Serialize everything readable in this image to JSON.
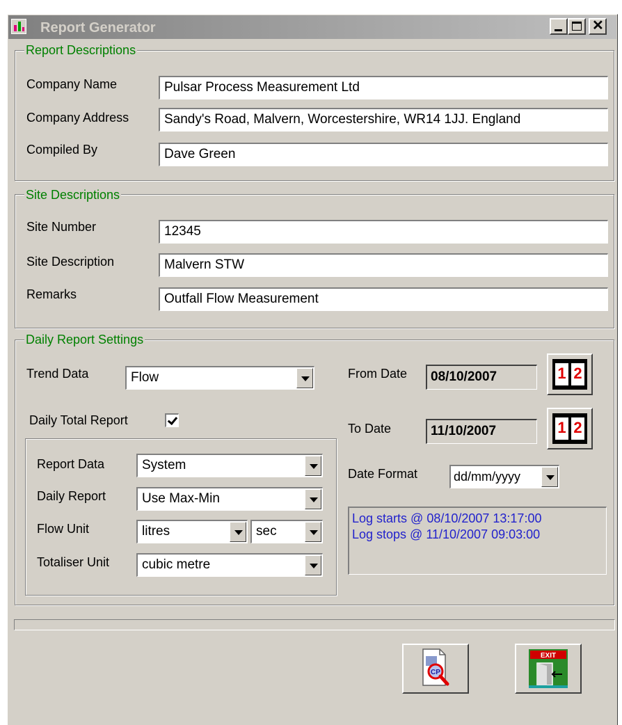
{
  "window": {
    "title": "Report Generator"
  },
  "report_descriptions": {
    "title": "Report Descriptions",
    "company_name_label": "Company Name",
    "company_name": "Pulsar Process Measurement Ltd",
    "company_address_label": "Company Address",
    "company_address": "Sandy's Road, Malvern, Worcestershire, WR14 1JJ. England",
    "compiled_by_label": "Compiled By",
    "compiled_by": "Dave Green"
  },
  "site_descriptions": {
    "title": "Site Descriptions",
    "site_number_label": "Site Number",
    "site_number": "12345",
    "site_description_label": "Site Description",
    "site_description": "Malvern STW",
    "remarks_label": "Remarks",
    "remarks": "Outfall Flow Measurement"
  },
  "daily_settings": {
    "title": "Daily Report Settings",
    "trend_data_label": "Trend Data",
    "trend_data": "Flow",
    "daily_total_label": "Daily Total Report",
    "daily_total_checked": true,
    "report_data_label": "Report Data",
    "report_data": "System",
    "daily_report_label": "Daily Report",
    "daily_report": "Use Max-Min",
    "flow_unit_label": "Flow Unit",
    "flow_unit": "litres",
    "flow_time_unit": "sec",
    "totaliser_unit_label": "Totaliser Unit",
    "totaliser_unit": "cubic metre",
    "from_date_label": "From Date",
    "from_date": "08/10/2007",
    "to_date_label": "To Date",
    "to_date": "11/10/2007",
    "date_format_label": "Date Format",
    "date_format": "dd/mm/yyyy",
    "log_start": "Log starts @ 08/10/2007 13:17:00",
    "log_stop": "Log stops @ 11/10/2007 09:03:00"
  },
  "buttons": {
    "preview_text": "CP",
    "exit_text": "EXIT"
  },
  "icons": {
    "calendar_pages": [
      "1",
      "2"
    ]
  }
}
